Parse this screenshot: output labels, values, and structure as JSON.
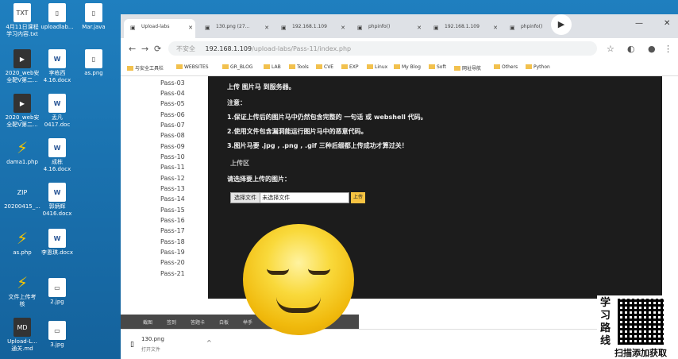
{
  "desktop": {
    "icons": [
      {
        "label": "4月11日课程\n学习内容.txt",
        "kind": "txt"
      },
      {
        "label": "uploadlab...",
        "kind": "file"
      },
      {
        "label": "Mar.java",
        "kind": "file"
      },
      {
        "label": "2020_web安\n全靶V第二...",
        "kind": "dark"
      },
      {
        "label": "李栋西\n4.16.docx",
        "kind": "word"
      },
      {
        "label": "as.png",
        "kind": "file"
      },
      {
        "label": "2020_web安\n全靶V第二...",
        "kind": "dark"
      },
      {
        "label": "孟凡\n0417.doc",
        "kind": "word"
      },
      {
        "label": "dama1.php",
        "kind": "php"
      },
      {
        "label": "成栋\n4.16.docx",
        "kind": "word"
      },
      {
        "label": "20200415_...",
        "kind": "zip"
      },
      {
        "label": "郭炳辉\n0416.docx",
        "kind": "word"
      },
      {
        "label": "as.php",
        "kind": "php"
      },
      {
        "label": "李恩琪.docx",
        "kind": "word"
      },
      {
        "label": "文件上传考\n核",
        "kind": "php"
      },
      {
        "label": "2.jpg",
        "kind": "file"
      },
      {
        "label": "Upload-L...\n通关.md",
        "kind": "md"
      },
      {
        "label": "3.jpg",
        "kind": "file"
      }
    ]
  },
  "browser": {
    "tabs": [
      {
        "label": "Upload-labs"
      },
      {
        "label": "130.png (27..."
      },
      {
        "label": "192.168.1.109"
      },
      {
        "label": "phpinfo()"
      },
      {
        "label": "192.168.1.109"
      },
      {
        "label": "phpinfo()"
      }
    ],
    "url_prefix": "不安全",
    "url_host": "192.168.1.109",
    "url_path": "/upload-labs/Pass-11/index.php",
    "bookmarks": [
      "与安全工具栏",
      "WEBSITES",
      "GR_BLOG",
      "LAB",
      "Tools",
      "CVE",
      "EXP",
      "Linux",
      "My Blog",
      "Soft",
      "网址导航",
      "Others",
      "Python"
    ]
  },
  "sidebar": {
    "passes": [
      "Pass-03",
      "Pass-04",
      "Pass-05",
      "Pass-06",
      "Pass-07",
      "Pass-08",
      "Pass-09",
      "Pass-10",
      "Pass-11",
      "Pass-12",
      "Pass-13",
      "Pass-14",
      "Pass-15",
      "Pass-16",
      "Pass-17",
      "Pass-18",
      "Pass-19",
      "Pass-20",
      "Pass-21"
    ]
  },
  "task": {
    "line0": "上传 图片马 到服务器。",
    "note": "注意：",
    "line1": "1.保证上传后的图片马中仍然包含完整的 一句话 或 webshell 代码。",
    "line2": "2.使用文件包含漏洞能运行图片马中的恶意代码。",
    "line3": "3.图片马要 .jpg , .png , .gif 三种后缀都上传成功才算过关！",
    "section": "上传区",
    "prompt": "请选择要上传的图片：",
    "choose_label": "选择文件",
    "no_file": "未选择文件",
    "upload_label": "上传"
  },
  "overlay_toolbar": [
    "截图",
    "签到",
    "答题卡",
    "白板",
    "举手",
    "投票",
    "工具"
  ],
  "download": {
    "file": "130.png",
    "action": "打开文件"
  },
  "promo": {
    "vertical": "学习路线",
    "scan": "扫描添加获取"
  }
}
